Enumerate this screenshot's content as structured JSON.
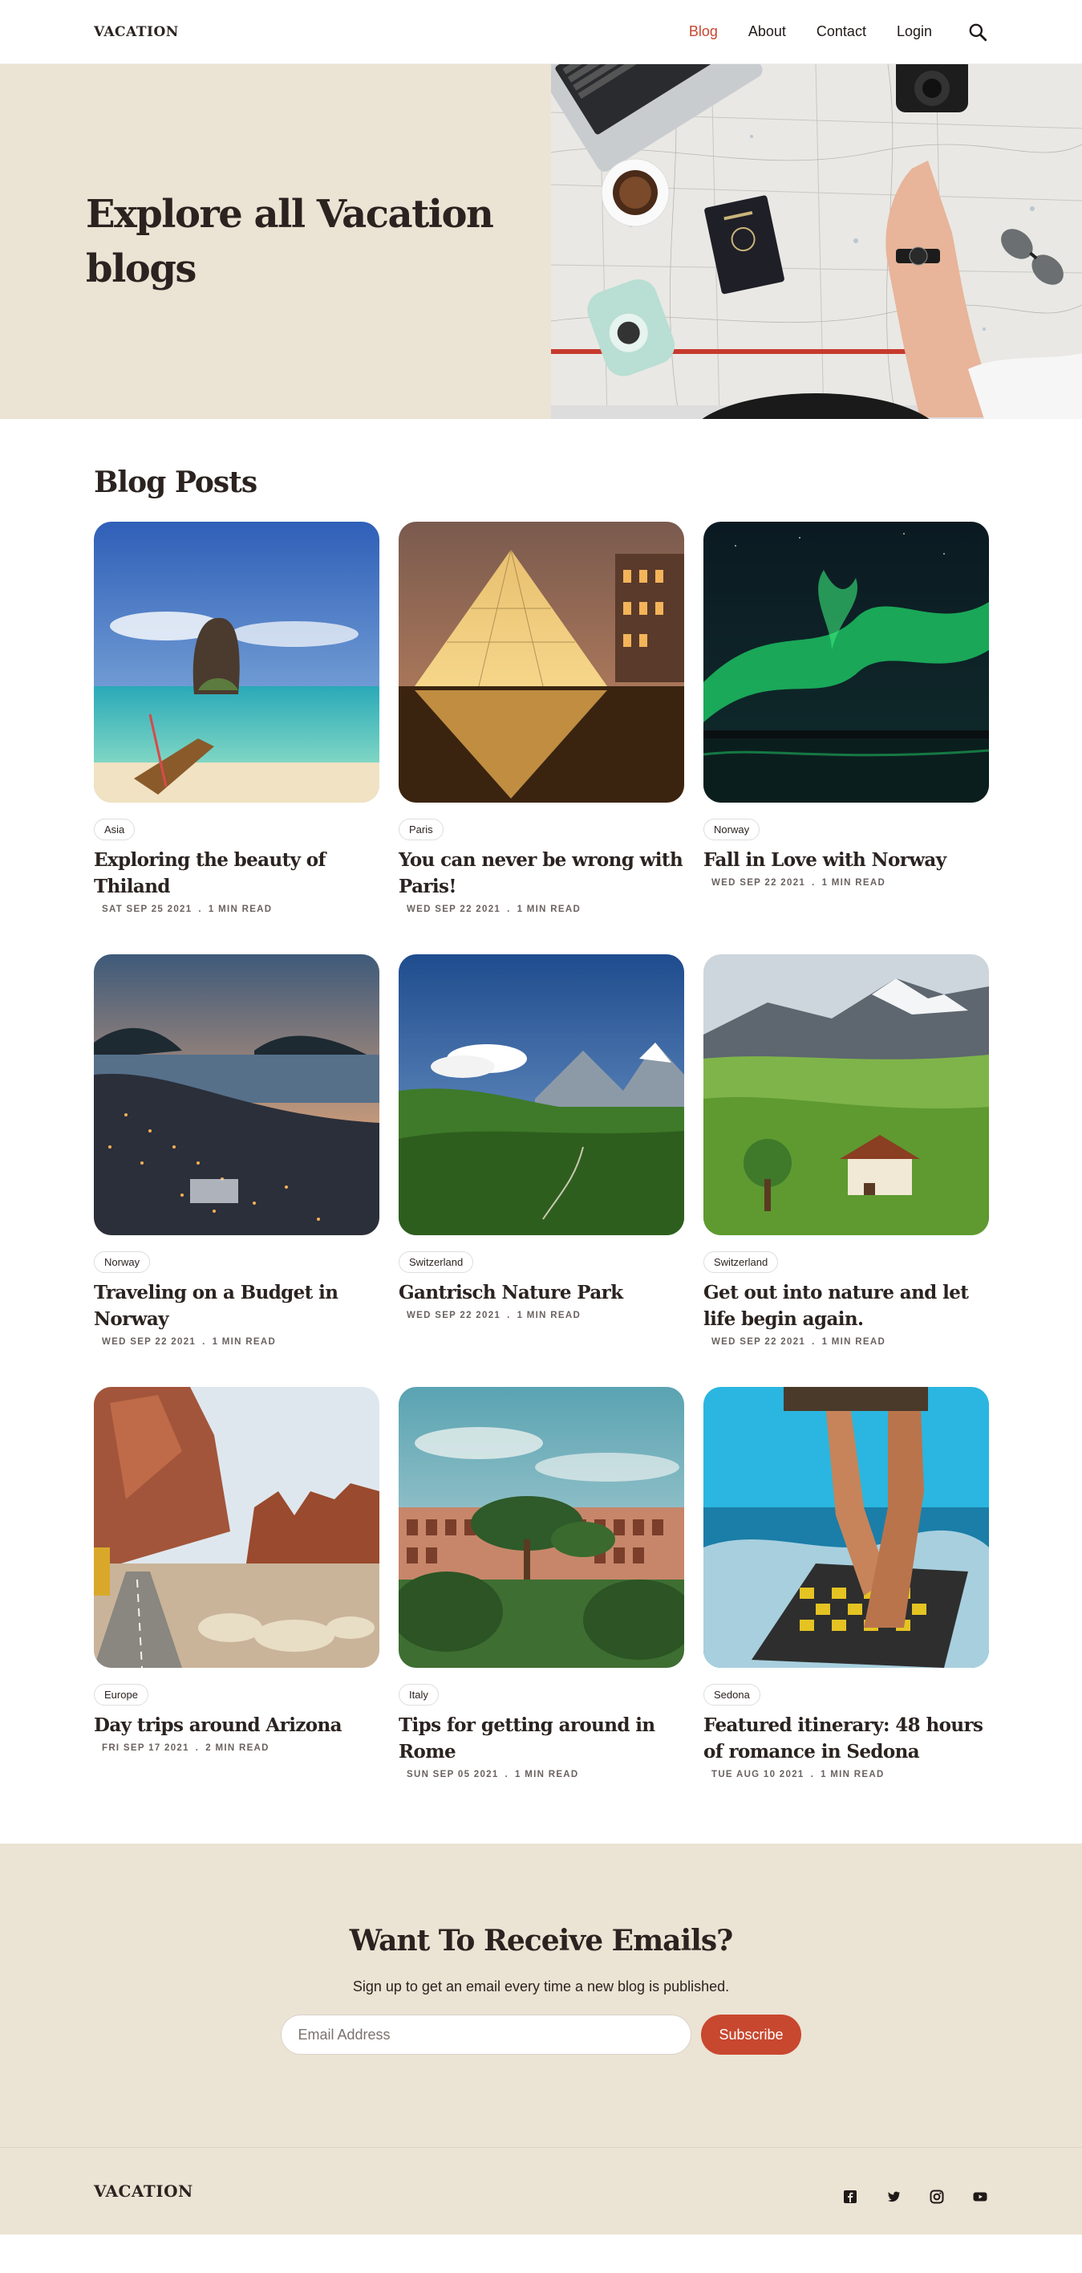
{
  "nav": {
    "brand": "VACATION",
    "links": [
      {
        "label": "Blog",
        "active": true
      },
      {
        "label": "About"
      },
      {
        "label": "Contact"
      },
      {
        "label": "Login"
      }
    ],
    "search_icon": "search-icon"
  },
  "hero": {
    "title_line1": "Explore all Vacation",
    "title_line2": "blogs",
    "image": "travel-map-flatlay"
  },
  "posts": {
    "heading": "Blog Posts",
    "items": [
      {
        "tag": "Asia",
        "title": "Exploring the beauty of Thiland",
        "date": "SAT SEP 25 2021",
        "read": "1 MIN READ"
      },
      {
        "tag": "Paris",
        "title": "You can never be wrong with Paris!",
        "date": "WED SEP 22 2021",
        "read": "1 MIN READ"
      },
      {
        "tag": "Norway",
        "title": "Fall in Love with Norway",
        "date": "WED SEP 22 2021",
        "read": "1 MIN READ"
      },
      {
        "tag": "Norway",
        "title": "Traveling on a Budget in Norway",
        "date": "WED SEP 22 2021",
        "read": "1 MIN READ"
      },
      {
        "tag": "Switzerland",
        "title": "Gantrisch Nature Park",
        "date": "WED SEP 22 2021",
        "read": "1 MIN READ"
      },
      {
        "tag": "Switzerland",
        "title": "Get out into nature and let life begin again.",
        "date": "WED SEP 22 2021",
        "read": "1 MIN READ"
      },
      {
        "tag": "Europe",
        "title": "Day trips around Arizona",
        "date": "FRI SEP 17 2021",
        "read": "2 MIN READ"
      },
      {
        "tag": "Italy",
        "title": "Tips for getting around in Rome",
        "date": "SUN SEP 05 2021",
        "read": "1 MIN READ"
      },
      {
        "tag": "Sedona",
        "title": "Featured itinerary: 48 hours of romance in Sedona",
        "date": "TUE AUG 10 2021",
        "read": "1 MIN READ"
      }
    ],
    "separator": "."
  },
  "subscribe": {
    "title": "Want To Receive Emails?",
    "text": "Sign up to get an email every time a new blog is published.",
    "placeholder": "Email Address",
    "button": "Subscribe"
  },
  "footer": {
    "brand": "VACATION",
    "socials": [
      "facebook-icon",
      "twitter-icon",
      "instagram-icon",
      "youtube-icon"
    ]
  },
  "colors": {
    "accent": "#c8472f",
    "sand": "#ebe3d3",
    "text": "#2b2320"
  }
}
